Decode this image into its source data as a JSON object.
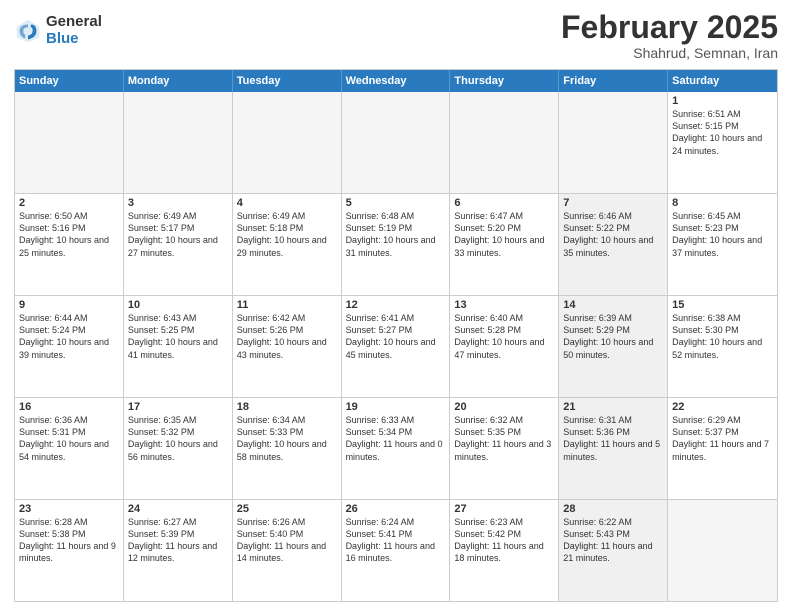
{
  "logo": {
    "general": "General",
    "blue": "Blue"
  },
  "header": {
    "month": "February 2025",
    "location": "Shahrud, Semnan, Iran"
  },
  "weekdays": [
    "Sunday",
    "Monday",
    "Tuesday",
    "Wednesday",
    "Thursday",
    "Friday",
    "Saturday"
  ],
  "rows": [
    [
      {
        "day": "",
        "text": "",
        "empty": true
      },
      {
        "day": "",
        "text": "",
        "empty": true
      },
      {
        "day": "",
        "text": "",
        "empty": true
      },
      {
        "day": "",
        "text": "",
        "empty": true
      },
      {
        "day": "",
        "text": "",
        "empty": true
      },
      {
        "day": "",
        "text": "",
        "empty": true
      },
      {
        "day": "1",
        "text": "Sunrise: 6:51 AM\nSunset: 5:15 PM\nDaylight: 10 hours and 24 minutes.",
        "empty": false
      }
    ],
    [
      {
        "day": "2",
        "text": "Sunrise: 6:50 AM\nSunset: 5:16 PM\nDaylight: 10 hours and 25 minutes.",
        "empty": false
      },
      {
        "day": "3",
        "text": "Sunrise: 6:49 AM\nSunset: 5:17 PM\nDaylight: 10 hours and 27 minutes.",
        "empty": false
      },
      {
        "day": "4",
        "text": "Sunrise: 6:49 AM\nSunset: 5:18 PM\nDaylight: 10 hours and 29 minutes.",
        "empty": false
      },
      {
        "day": "5",
        "text": "Sunrise: 6:48 AM\nSunset: 5:19 PM\nDaylight: 10 hours and 31 minutes.",
        "empty": false
      },
      {
        "day": "6",
        "text": "Sunrise: 6:47 AM\nSunset: 5:20 PM\nDaylight: 10 hours and 33 minutes.",
        "empty": false
      },
      {
        "day": "7",
        "text": "Sunrise: 6:46 AM\nSunset: 5:22 PM\nDaylight: 10 hours and 35 minutes.",
        "empty": false
      },
      {
        "day": "8",
        "text": "Sunrise: 6:45 AM\nSunset: 5:23 PM\nDaylight: 10 hours and 37 minutes.",
        "empty": false
      }
    ],
    [
      {
        "day": "9",
        "text": "Sunrise: 6:44 AM\nSunset: 5:24 PM\nDaylight: 10 hours and 39 minutes.",
        "empty": false
      },
      {
        "day": "10",
        "text": "Sunrise: 6:43 AM\nSunset: 5:25 PM\nDaylight: 10 hours and 41 minutes.",
        "empty": false
      },
      {
        "day": "11",
        "text": "Sunrise: 6:42 AM\nSunset: 5:26 PM\nDaylight: 10 hours and 43 minutes.",
        "empty": false
      },
      {
        "day": "12",
        "text": "Sunrise: 6:41 AM\nSunset: 5:27 PM\nDaylight: 10 hours and 45 minutes.",
        "empty": false
      },
      {
        "day": "13",
        "text": "Sunrise: 6:40 AM\nSunset: 5:28 PM\nDaylight: 10 hours and 47 minutes.",
        "empty": false
      },
      {
        "day": "14",
        "text": "Sunrise: 6:39 AM\nSunset: 5:29 PM\nDaylight: 10 hours and 50 minutes.",
        "empty": false
      },
      {
        "day": "15",
        "text": "Sunrise: 6:38 AM\nSunset: 5:30 PM\nDaylight: 10 hours and 52 minutes.",
        "empty": false
      }
    ],
    [
      {
        "day": "16",
        "text": "Sunrise: 6:36 AM\nSunset: 5:31 PM\nDaylight: 10 hours and 54 minutes.",
        "empty": false
      },
      {
        "day": "17",
        "text": "Sunrise: 6:35 AM\nSunset: 5:32 PM\nDaylight: 10 hours and 56 minutes.",
        "empty": false
      },
      {
        "day": "18",
        "text": "Sunrise: 6:34 AM\nSunset: 5:33 PM\nDaylight: 10 hours and 58 minutes.",
        "empty": false
      },
      {
        "day": "19",
        "text": "Sunrise: 6:33 AM\nSunset: 5:34 PM\nDaylight: 11 hours and 0 minutes.",
        "empty": false
      },
      {
        "day": "20",
        "text": "Sunrise: 6:32 AM\nSunset: 5:35 PM\nDaylight: 11 hours and 3 minutes.",
        "empty": false
      },
      {
        "day": "21",
        "text": "Sunrise: 6:31 AM\nSunset: 5:36 PM\nDaylight: 11 hours and 5 minutes.",
        "empty": false
      },
      {
        "day": "22",
        "text": "Sunrise: 6:29 AM\nSunset: 5:37 PM\nDaylight: 11 hours and 7 minutes.",
        "empty": false
      }
    ],
    [
      {
        "day": "23",
        "text": "Sunrise: 6:28 AM\nSunset: 5:38 PM\nDaylight: 11 hours and 9 minutes.",
        "empty": false
      },
      {
        "day": "24",
        "text": "Sunrise: 6:27 AM\nSunset: 5:39 PM\nDaylight: 11 hours and 12 minutes.",
        "empty": false
      },
      {
        "day": "25",
        "text": "Sunrise: 6:26 AM\nSunset: 5:40 PM\nDaylight: 11 hours and 14 minutes.",
        "empty": false
      },
      {
        "day": "26",
        "text": "Sunrise: 6:24 AM\nSunset: 5:41 PM\nDaylight: 11 hours and 16 minutes.",
        "empty": false
      },
      {
        "day": "27",
        "text": "Sunrise: 6:23 AM\nSunset: 5:42 PM\nDaylight: 11 hours and 18 minutes.",
        "empty": false
      },
      {
        "day": "28",
        "text": "Sunrise: 6:22 AM\nSunset: 5:43 PM\nDaylight: 11 hours and 21 minutes.",
        "empty": false
      },
      {
        "day": "",
        "text": "",
        "empty": true
      }
    ]
  ]
}
